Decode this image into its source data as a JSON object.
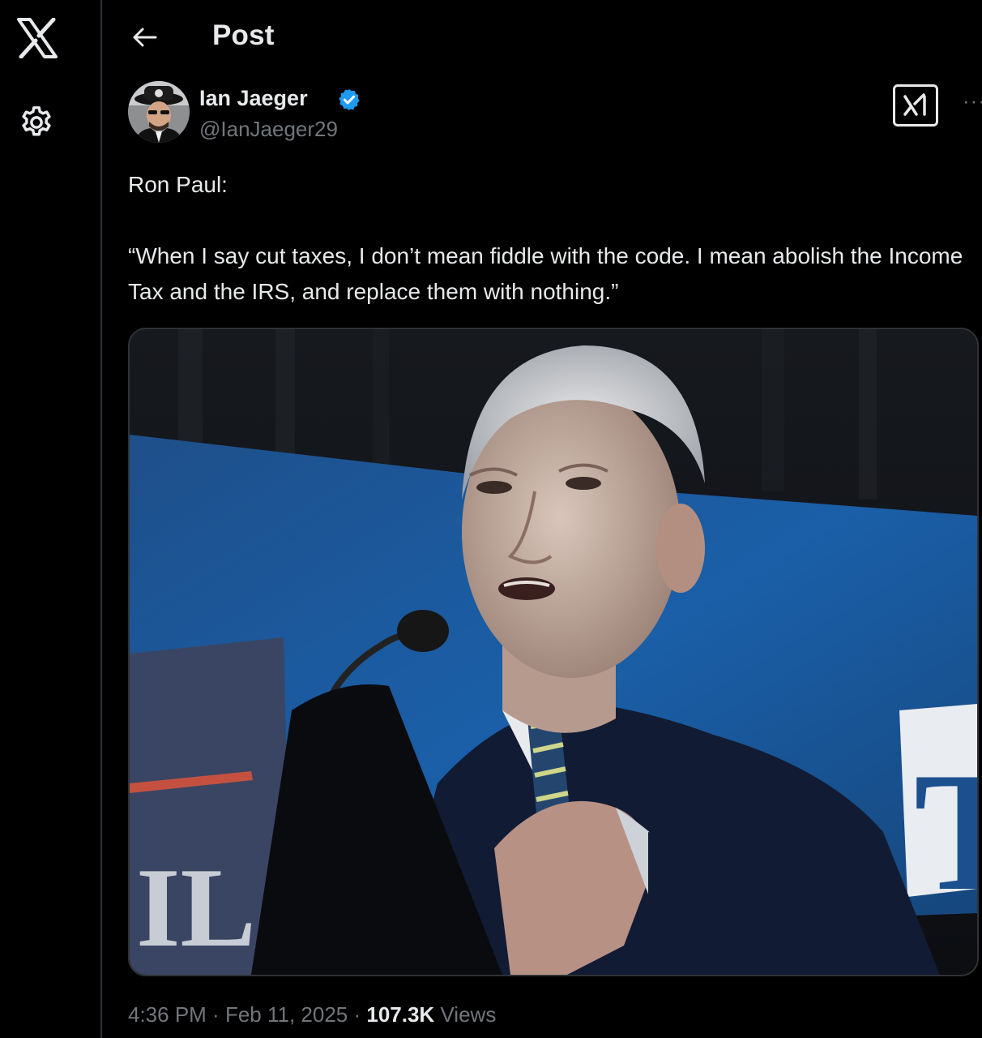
{
  "header": {
    "title": "Post",
    "back_icon": "arrow-left-icon"
  },
  "nav": {
    "logo_icon": "x-logo-icon",
    "settings_icon": "gear-icon"
  },
  "post": {
    "author": {
      "display_name": "Ian Jaeger",
      "handle": "@IanJaeger29",
      "verified": true,
      "verified_color": "#1d9bf0"
    },
    "text": "Ron Paul:\n\n“When I say cut taxes, I don’t mean fiddle with the code. I mean abolish the Income Tax and the IRS, and replace them with nothing.”",
    "media": {
      "banner_letters_left": "IL",
      "banner_letters_right": "T"
    },
    "meta": {
      "time": "4:36 PM",
      "separator": " · ",
      "date": "Feb 11, 2025",
      "views_count": "107.3K",
      "views_label": "Views"
    }
  },
  "actions": {
    "grok_icon": "grok-icon",
    "more_label": "···"
  },
  "colors": {
    "background": "#000000",
    "text_primary": "#e7e9ea",
    "text_secondary": "#71767b",
    "border": "#2f3336",
    "accent": "#1d9bf0"
  }
}
